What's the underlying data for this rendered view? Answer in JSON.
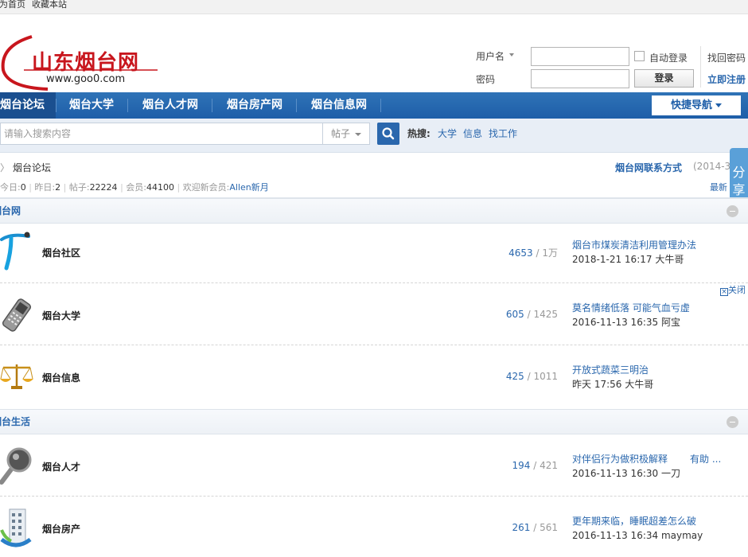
{
  "topbar": {
    "home": "设为首页",
    "favorite": "收藏本站"
  },
  "logo": {
    "cn": "山东烟台网",
    "url": "www.goo0.com"
  },
  "login": {
    "username_label": "用户名",
    "password_label": "密码",
    "auto_login": "自动登录",
    "login_button": "登录",
    "find_password": "找回密码",
    "register": "立即注册"
  },
  "nav": {
    "items": [
      "烟台论坛",
      "烟台大学",
      "烟台人才网",
      "烟台房产网",
      "烟台信息网"
    ],
    "quick_nav": "快捷导航"
  },
  "search": {
    "placeholder": "请输入搜索内容",
    "type": "帖子",
    "hot_label": "热搜:",
    "hot_items": [
      "大学",
      "信息",
      "找工作"
    ]
  },
  "share": {
    "label": "分享"
  },
  "info": {
    "breadcrumb": "烟台论坛",
    "contact": "烟台网联系方式",
    "contact_date": "(2014-3",
    "stats_today_label": "今日:",
    "stats_today": "0",
    "stats_yesterday_label": "昨日:",
    "stats_yesterday": "2",
    "stats_posts_label": "帖子:",
    "stats_posts": "22224",
    "stats_members_label": "会员:",
    "stats_members": "44100",
    "welcome_label": "欢迎新会员:",
    "new_member": "Allen新月",
    "latest": "最新"
  },
  "categories": [
    {
      "title": "烟台网",
      "forums": [
        {
          "name": "烟台社区",
          "threads": "4653",
          "posts": "1万",
          "last_title": "烟台市煤炭清洁利用管理办法",
          "last_time": "2018-1-21 16:17 大牛哥",
          "icon": "letter-t-icon"
        },
        {
          "name": "烟台大学",
          "threads": "605",
          "posts": "1425",
          "last_title": "莫名情绪低落 可能气血亏虚",
          "last_time": "2016-11-13 16:35 阿宝",
          "icon": "mobile-phone-icon"
        },
        {
          "name": "烟台信息",
          "threads": "425",
          "posts": "1011",
          "last_title": "开放式蔬菜三明治",
          "last_time": "昨天 17:56 大牛哥",
          "icon": "scales-icon"
        }
      ]
    },
    {
      "title": "烟台生活",
      "forums": [
        {
          "name": "烟台人才",
          "threads": "194",
          "posts": "421",
          "last_title": "对伴侣行为做积极解释",
          "last_title_extra": "有助 ...",
          "last_time": "2016-11-13 16:30 一刀",
          "icon": "magnifier-icon"
        },
        {
          "name": "烟台房产",
          "threads": "261",
          "posts": "561",
          "last_title": "更年期来临，睡眠超差怎么破",
          "last_time": "2016-11-13 16:34 maymay",
          "icon": "building-icon"
        }
      ]
    }
  ],
  "ad": {
    "close": "关闭"
  },
  "colors": {
    "brand_blue": "#1e5ea8",
    "link_blue": "#2a67ad",
    "logo_red": "#c8161d"
  }
}
